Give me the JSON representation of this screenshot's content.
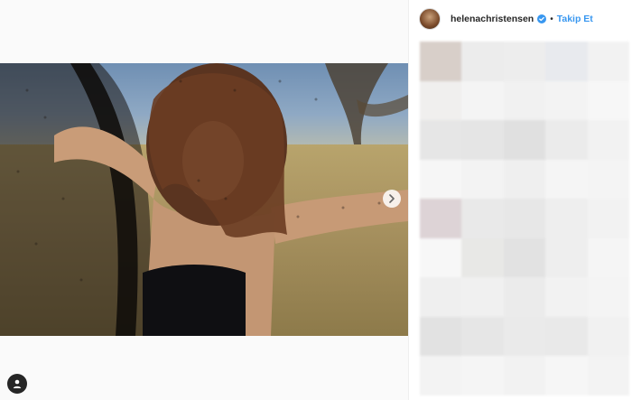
{
  "post": {
    "username": "helenachristensen",
    "verified": true,
    "separator": "•",
    "follow_label": "Takip Et"
  },
  "icons": {
    "next": "chevron-right-icon",
    "user": "user-profile-icon",
    "verified": "verified-badge-icon"
  },
  "colors": {
    "link_blue": "#3897f0",
    "text": "#262626",
    "sidebar_bg": "#ffffff",
    "page_bg": "#fafafa"
  },
  "blurred_comment_cells": [
    "#d8cfc9",
    "#ececec",
    "#ededed",
    "#e8eaee",
    "#f2f2f2",
    "#f0efee",
    "#f4f4f4",
    "#f1f1f1",
    "#f3f3f3",
    "#f7f7f7",
    "#e6e6e6",
    "#e5e5e5",
    "#e0e0e0",
    "#ebebeb",
    "#f2f2f2",
    "#f6f6f6",
    "#f3f3f3",
    "#efefef",
    "#f5f5f5",
    "#f4f4f4",
    "#ddd3d6",
    "#e9e9e9",
    "#e7e7e7",
    "#eeeeee",
    "#f2f2f2",
    "#f7f7f7",
    "#e8e8e6",
    "#e2e2e2",
    "#eeeeee",
    "#f5f5f5",
    "#efefef",
    "#f0f0f0",
    "#ebebeb",
    "#f2f2f2",
    "#f4f4f4",
    "#e2e2e2",
    "#e6e6e6",
    "#eaeaea",
    "#e9e9e9",
    "#f1f1f1",
    "#f3f3f3",
    "#f5f5f5",
    "#f2f2f2",
    "#f6f6f6",
    "#f3f3f3"
  ]
}
